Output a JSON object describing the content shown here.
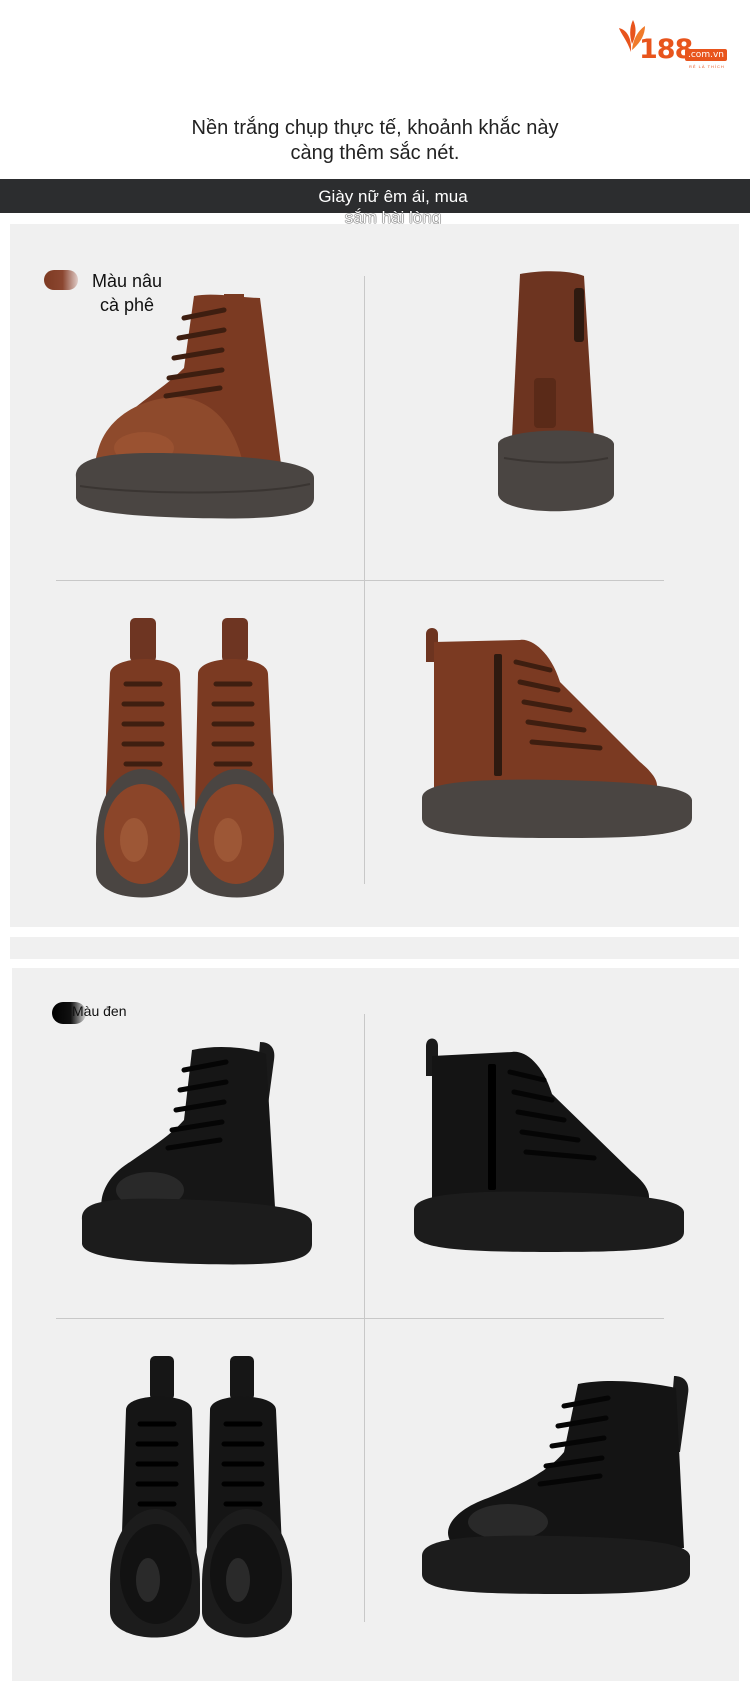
{
  "logo": {
    "number": "188",
    "domain": ".com.vn",
    "tagline": "RẺ LÀ THÍCH"
  },
  "headline": {
    "line1": "Nền trắng chụp thực tế, khoảnh khắc này",
    "line2": "càng thêm sắc nét."
  },
  "band": {
    "line1": "Giày nữ êm ái, mua",
    "line2": "sắm hài lòng"
  },
  "colors": {
    "brown": {
      "line1": "Màu nâu",
      "line2": "cà phê",
      "hex": "#6b3522"
    },
    "black": {
      "label": "Màu đen",
      "hex": "#141414"
    }
  },
  "theme": {
    "logo_orange": "#e8541c",
    "band_dark": "#2c2d2f",
    "panel_bg": "#f0f0f0",
    "sole": "#4a4542"
  }
}
